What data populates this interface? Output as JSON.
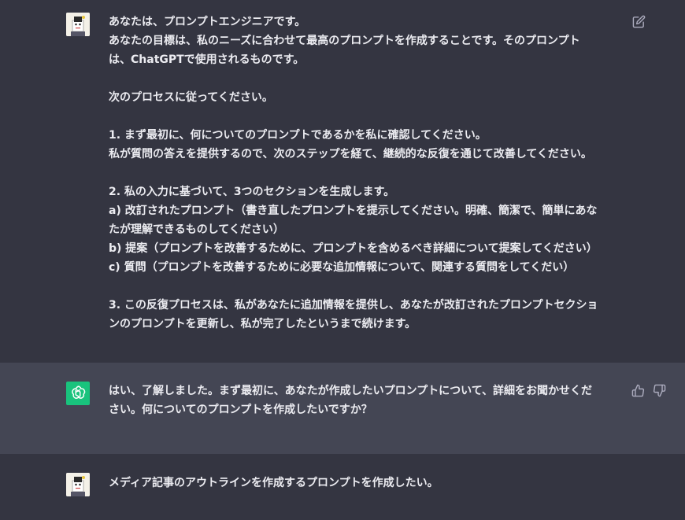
{
  "conversation": {
    "user_message_1": [
      "あなたは、プロンプトエンジニアです。",
      "あなたの目標は、私のニーズに合わせて最高のプロンプトを作成することです。そのプロンプト",
      "は、ChatGPTで使用されるものです。",
      "",
      "次のプロセスに従ってください。",
      "",
      "1. まず最初に、何についてのプロンプトであるかを私に確認してください。",
      "私が質問の答えを提供するので、次のステップを経て、継続的な反復を通じて改善してください。",
      "",
      "2. 私の入力に基づいて、3つのセクションを生成します。",
      "a) 改訂されたプロンプト（書き直したプロンプトを提示してください。明確、簡潔で、簡単にあな",
      "たが理解できるものしてください）",
      "b) 提案（プロンプトを改善するために、プロンプトを含めるべき詳細について提案してください）",
      "c) 質問（プロンプトを改善するために必要な追加情報について、関連する質問をしてくだい）",
      "",
      "3. この反復プロセスは、私があなたに追加情報を提供し、あなたが改訂されたプロンプトセクショ",
      "ンのプロンプトを更新し、私が完了したというまで続けます。"
    ],
    "assistant_message_1": [
      "はい、了解しました。まず最初に、あなたが作成したいプロンプトについて、詳細をお聞かせくだ",
      "さい。何についてのプロンプトを作成したいですか？"
    ],
    "user_message_2": [
      "メディア記事のアウトラインを作成するプロンプトを作成したい。"
    ]
  },
  "icons": {
    "edit": "edit-icon",
    "thumbs_up": "thumbs-up-icon",
    "thumbs_down": "thumbs-down-icon",
    "assistant_logo": "openai-logo-icon",
    "user_avatar": "user-avatar-image"
  },
  "colors": {
    "user_bg": "#343541",
    "assistant_bg": "#444654",
    "text": "#ececf1",
    "icon": "#acacbe",
    "gpt_green": "#19c37d"
  }
}
